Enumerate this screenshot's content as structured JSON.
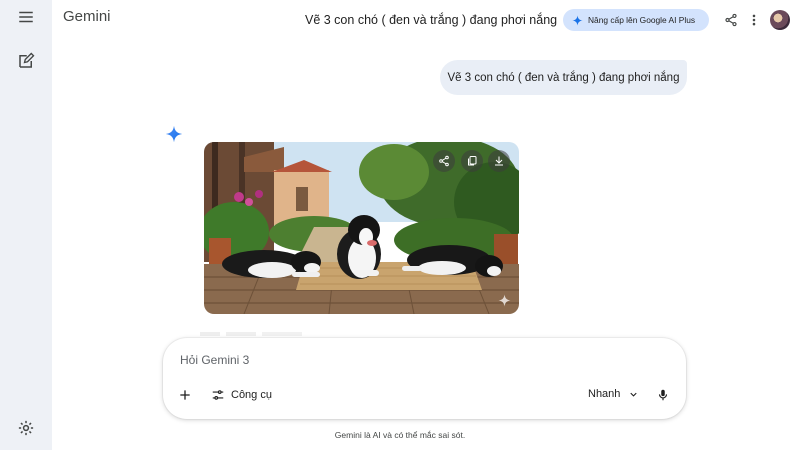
{
  "app": {
    "brand": "Gemini"
  },
  "header": {
    "chat_title": "Vẽ 3 con chó ( đen và trắng ) đang phơi nắng",
    "upgrade_label": "Nâng cấp lên Google AI Plus",
    "accent_color": "#d3e3fd"
  },
  "sidebar": {
    "items": [
      {
        "icon": "menu-icon"
      },
      {
        "icon": "new-chat-icon"
      },
      {
        "icon": "settings-icon"
      }
    ],
    "background": "#eef1f6"
  },
  "conversation": {
    "user_message": "Vẽ 3 con chó ( đen và trắng ) đang phơi nắng",
    "response": {
      "type": "generated-image",
      "description_icons": [
        "share-icon",
        "copy-icon",
        "download-icon"
      ]
    }
  },
  "composer": {
    "placeholder": "Hỏi Gemini 3",
    "tools_label": "Công cụ",
    "mode_label": "Nhanh"
  },
  "footer": {
    "disclaimer": "Gemini là AI và có thể mắc sai sót."
  }
}
